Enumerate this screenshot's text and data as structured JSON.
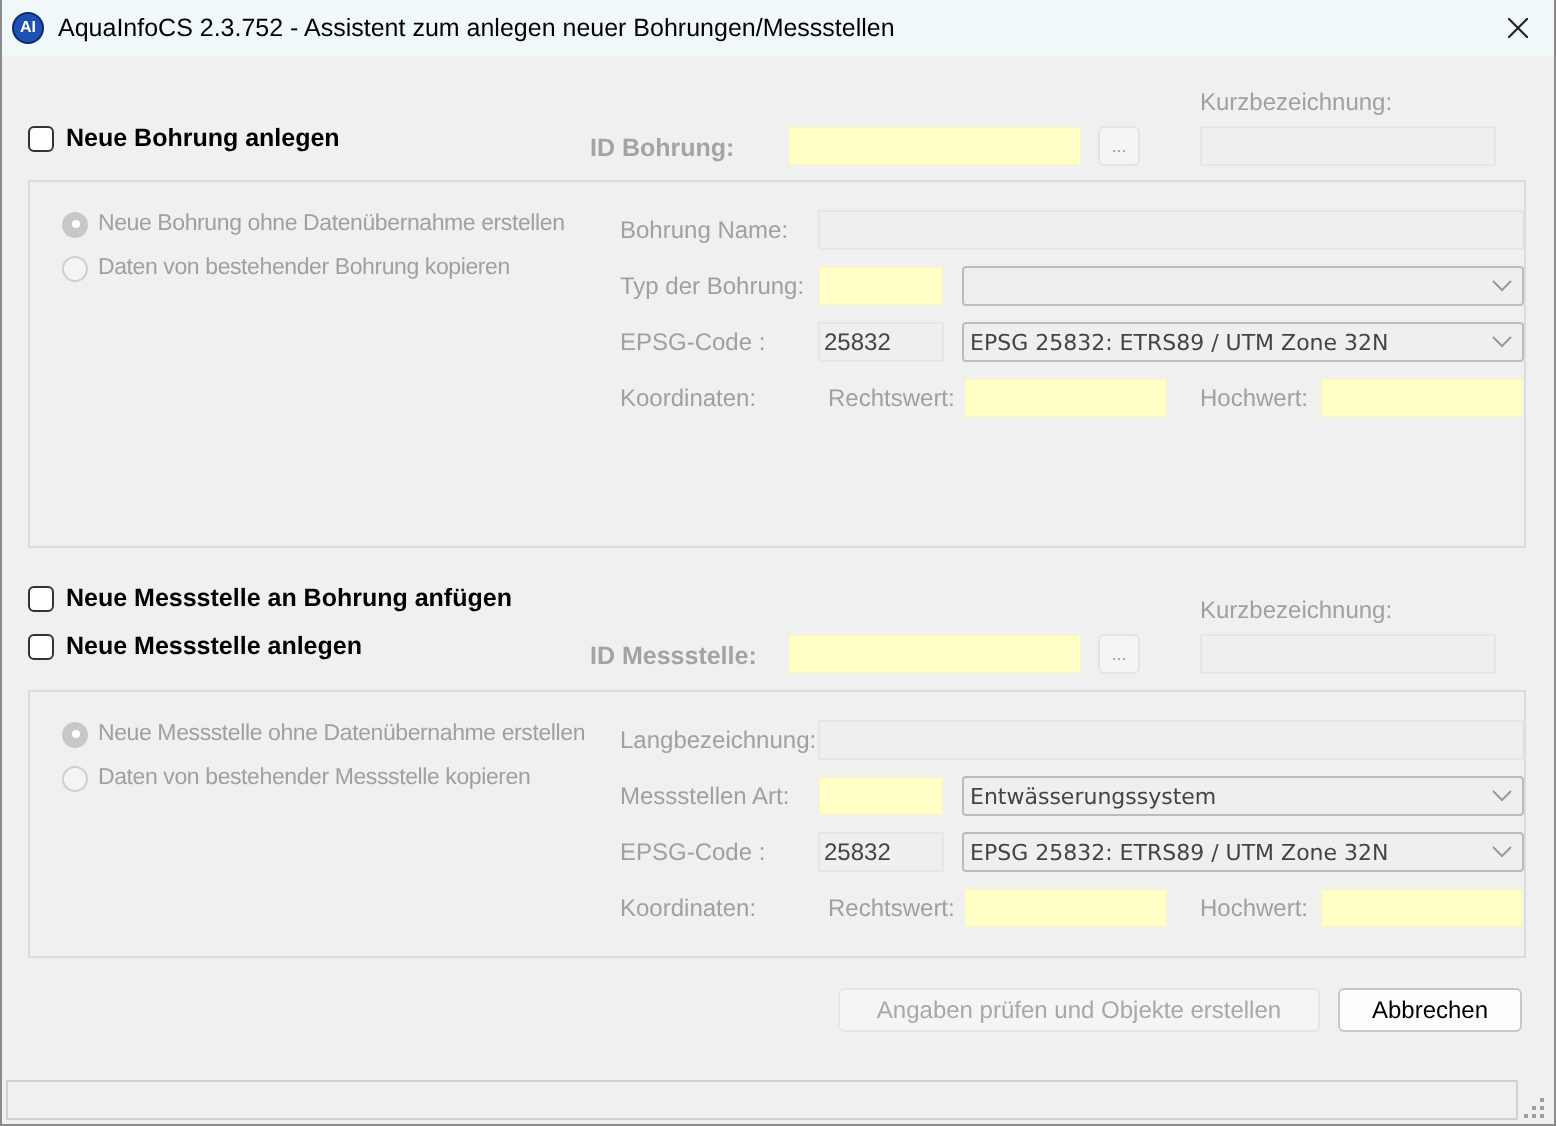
{
  "window": {
    "app_icon": "AI",
    "title": "AquaInfoCS 2.3.752 - Assistent zum anlegen neuer Bohrungen/Messstellen"
  },
  "sections": [
    {
      "checkboxes": [
        {
          "label": "Neue Bohrung anlegen",
          "checked": false
        }
      ],
      "id_label": "ID Bohrung:",
      "id_required": true,
      "browse_button": "...",
      "short_label": "Kurzbezeichnung:",
      "group": {
        "disabled": true,
        "radios": [
          {
            "label": "Neue Bohrung ohne Datenübernahme erstellen",
            "selected": true
          },
          {
            "label": "Daten von bestehender Bohrung kopieren",
            "selected": false
          }
        ],
        "rows": [
          {
            "kind": "text",
            "label": "Bohrung Name:",
            "required": false
          },
          {
            "kind": "combo",
            "label": "Typ der Bohrung:",
            "required": true
          },
          {
            "kind": "combo",
            "label": "EPSG-Code :",
            "required": false,
            "code": "25832",
            "value": "EPSG 25832: ETRS89 / UTM Zone 32N"
          },
          {
            "kind": "coords",
            "label": "Koordinaten:",
            "east_label": "Rechtswert:",
            "north_label": "Hochwert:",
            "required": true
          }
        ]
      }
    },
    {
      "checkboxes": [
        {
          "label": "Neue Messstelle an Bohrung anfügen",
          "checked": false
        },
        {
          "label": "Neue Messstelle anlegen",
          "checked": false
        }
      ],
      "id_label": "ID Messstelle:",
      "id_required": true,
      "browse_button": "...",
      "short_label": "Kurzbezeichnung:",
      "group": {
        "disabled": true,
        "radios": [
          {
            "label": "Neue Messstelle ohne Datenübernahme erstellen",
            "selected": true
          },
          {
            "label": "Daten von bestehender Messstelle kopieren",
            "selected": false
          }
        ],
        "rows": [
          {
            "kind": "text",
            "label": "Langbezeichnung:",
            "required": false
          },
          {
            "kind": "combo",
            "label": "Messstellen Art:",
            "required": true,
            "value": "Entwässerungssystem"
          },
          {
            "kind": "combo",
            "label": "EPSG-Code :",
            "required": false,
            "code": "25832",
            "value": "EPSG 25832: ETRS89 / UTM Zone 32N"
          },
          {
            "kind": "coords",
            "label": "Koordinaten:",
            "east_label": "Rechtswert:",
            "north_label": "Hochwert:",
            "required": true
          }
        ]
      }
    }
  ],
  "buttons": [
    {
      "label": "Angaben prüfen und Objekte erstellen",
      "disabled": true
    },
    {
      "label": "Abbrechen",
      "disabled": false
    }
  ]
}
